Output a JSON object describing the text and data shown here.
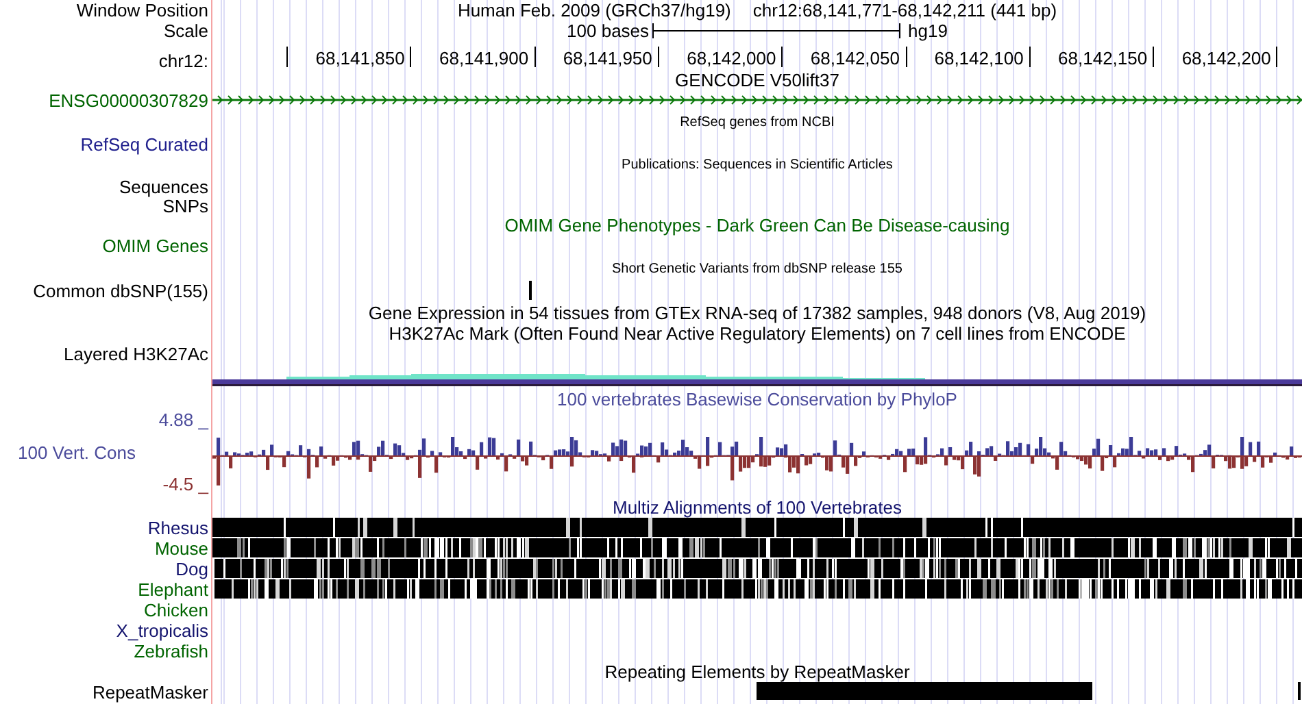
{
  "header": {
    "position_label": "Window Position",
    "assembly_title": "Human Feb. 2009 (GRCh37/hg19)",
    "position": "chr12:68,141,771-68,142,211 (441 bp)",
    "scale_label": "Scale",
    "scale_text": "100 bases",
    "scale_assembly": "hg19",
    "chrom_label": "chr12:",
    "ruler_ticks": [
      "68,141,850",
      "68,141,900",
      "68,141,950",
      "68,142,000",
      "68,142,050",
      "68,142,100",
      "68,142,150",
      "68,142,200"
    ]
  },
  "tracks": [
    {
      "kind": "gene",
      "title": "GENCODE V50lift37",
      "label": "ENSG00000307829",
      "color": "#006400"
    },
    {
      "kind": "blank",
      "title": "RefSeq genes from NCBI",
      "label": "RefSeq Curated",
      "color": "#1e1e8c"
    },
    {
      "kind": "blank",
      "title": "Publications: Sequences in Scientific Articles",
      "label": "Sequences",
      "color": "#000000"
    },
    {
      "kind": "blank",
      "label": "SNPs",
      "color": "#000000"
    },
    {
      "kind": "omim",
      "title": "OMIM Gene Phenotypes - Dark Green Can Be Disease-causing",
      "label": "OMIM Genes",
      "color": "#006400"
    },
    {
      "kind": "snp",
      "title": "Short Genetic Variants from dbSNP release 155",
      "label": "Common dbSNP(155)",
      "color": "#000000"
    },
    {
      "kind": "expression",
      "title": "Gene Expression in 54 tissues from GTEx RNA-seq of 17382 samples, 948 donors (V8, Aug 2019)"
    },
    {
      "kind": "layered",
      "title": "H3K27Ac Mark (Often Found Near Active Regulatory Elements) on 7 cell lines from ENCODE",
      "label": "Layered H3K27Ac",
      "color": "#000000"
    },
    {
      "kind": "wiggle",
      "title": "100 vertebrates Basewise Conservation by PhyloP",
      "label": "100 Vert. Cons",
      "color": "#4b4b9b",
      "max_label": "4.88 _",
      "min_label": "-4.5 _"
    },
    {
      "kind": "multiz",
      "title": "Multiz Alignments of 100 Vertebrates",
      "color": "#14146e",
      "species": [
        {
          "name": "Rhesus",
          "color": "#14146e",
          "aligned": true
        },
        {
          "name": "Mouse",
          "color": "#006400",
          "aligned": true
        },
        {
          "name": "Dog",
          "color": "#14146e",
          "aligned": true
        },
        {
          "name": "Elephant",
          "color": "#006400",
          "aligned": true
        },
        {
          "name": "Chicken",
          "color": "#006400",
          "aligned": false
        },
        {
          "name": "X_tropicalis",
          "color": "#14146e",
          "aligned": false
        },
        {
          "name": "Zebrafish",
          "color": "#006400",
          "aligned": false
        }
      ]
    },
    {
      "kind": "repeat",
      "title": "Repeating Elements by RepeatMasker",
      "label": "RepeatMasker",
      "color": "#000000"
    }
  ]
}
